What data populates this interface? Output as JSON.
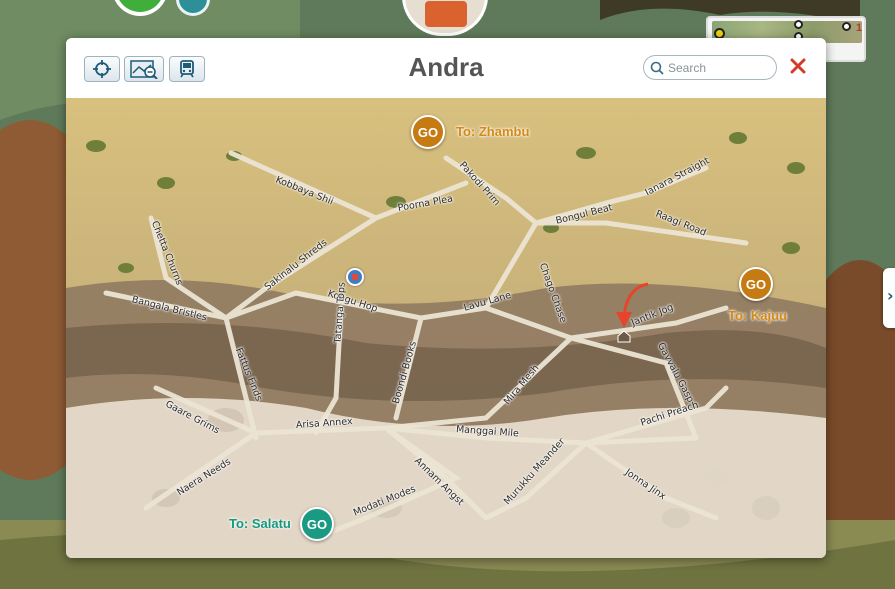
{
  "dialog": {
    "title": "Andra",
    "search_placeholder": "Search",
    "toolbar": [
      "locate-icon",
      "zoom-map-icon",
      "train-icon"
    ]
  },
  "mini_map": {
    "marker_number": "1"
  },
  "map": {
    "go_label": "GO",
    "destinations": [
      {
        "label": "To: Zhambu",
        "color": "#c57a12"
      },
      {
        "label": "To: Kajuu",
        "color": "#c57a12"
      },
      {
        "label": "To: Salatu",
        "color": "#1a9a82"
      }
    ],
    "streets": [
      "Kobbaya Shii",
      "Pakodi Prim",
      "Poorna Plea",
      "Ianara Straight",
      "Bongul Beat",
      "Raagi Road",
      "Chetta Churns",
      "Sakinalu Shreds",
      "Kongu Hop",
      "Chago Chase",
      "Lavu Lane",
      "Jantik Jog",
      "Bangala Bristles",
      "Fattus Finds",
      "Tatanga Tops",
      "Boondi Books",
      "Mira Mesh",
      "Gavvalu Gasp",
      "Gaare Grims",
      "Arisa Annex",
      "Manggai Mile",
      "Pachi Preach",
      "Naera Needs",
      "Modati Modes",
      "Annam Angst",
      "Murukku Meander",
      "Jonna Jinx"
    ]
  }
}
